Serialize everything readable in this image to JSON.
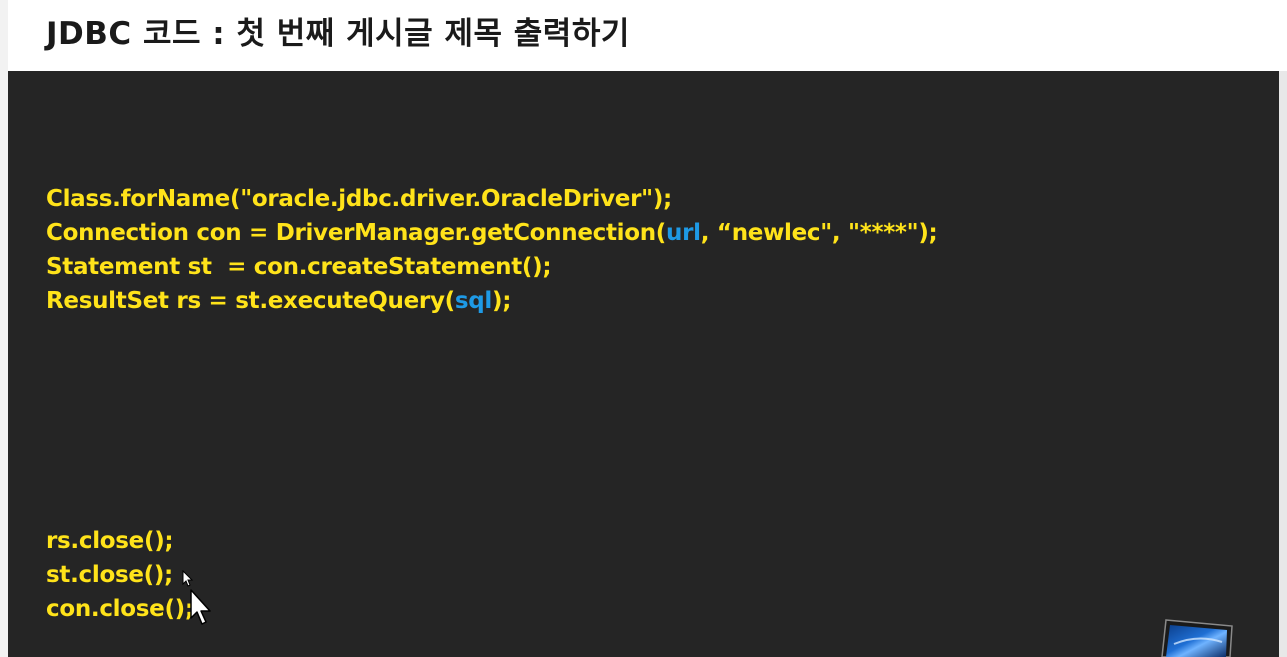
{
  "slide": {
    "title": "JDBC 코드 : 첫 번째 게시글 제목 출력하기"
  },
  "code": {
    "line1": "Class.forName(\"oracle.jdbc.driver.OracleDriver\");",
    "line2_a": "Connection con = DriverManager.getConnection(",
    "line2_url": "url",
    "line2_b": ", “newlec\", \"****\");",
    "line3": "Statement st  = con.createStatement();",
    "line4_a": "ResultSet rs = st.executeQuery(",
    "line4_sql": "sql",
    "line4_b": ");",
    "line5": "rs.close();",
    "line6": "st.close();",
    "line7": "con.close();"
  },
  "colors": {
    "code_text": "#ffe31a",
    "highlight": "#1e9ae6",
    "background": "#252525"
  },
  "icons": {
    "cursor": "mouse-pointer-icon",
    "corner": "monitor-icon"
  }
}
